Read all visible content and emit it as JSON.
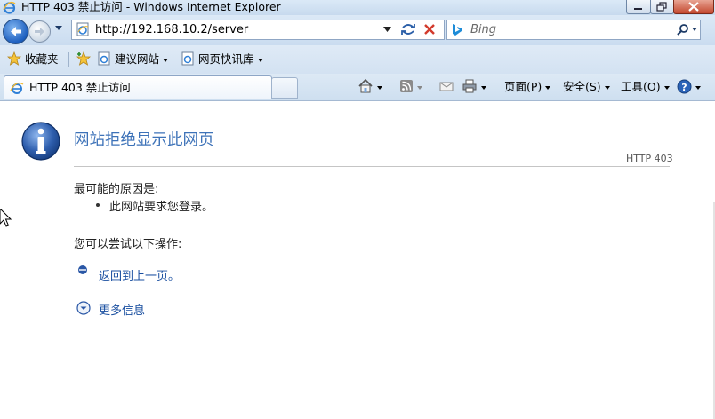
{
  "window": {
    "title": "HTTP 403 禁止访问 - Windows Internet Explorer"
  },
  "navigation": {
    "address": "http://192.168.10.2/server",
    "search_placeholder": "Bing"
  },
  "favorites_bar": {
    "favorites_label": "收藏夹",
    "items": [
      {
        "label": "建议网站"
      },
      {
        "label": "网页快讯库"
      }
    ]
  },
  "tabs": [
    {
      "label": "HTTP 403 禁止访问",
      "active": true
    }
  ],
  "command_bar": {
    "page": "页面(P)",
    "safety": "安全(S)",
    "tools": "工具(O)"
  },
  "content": {
    "heading": "网站拒绝显示此网页",
    "http_code": "HTTP 403",
    "cause_title": "最可能的原因是:",
    "cause_items": [
      "此网站要求您登录。"
    ],
    "try_title": "您可以尝试以下操作:",
    "back_link": "返回到上一页。",
    "more_info": "更多信息"
  },
  "colors": {
    "heading": "#3d72b8",
    "link": "#1a4fa0",
    "chrome": "#cadcf0"
  }
}
